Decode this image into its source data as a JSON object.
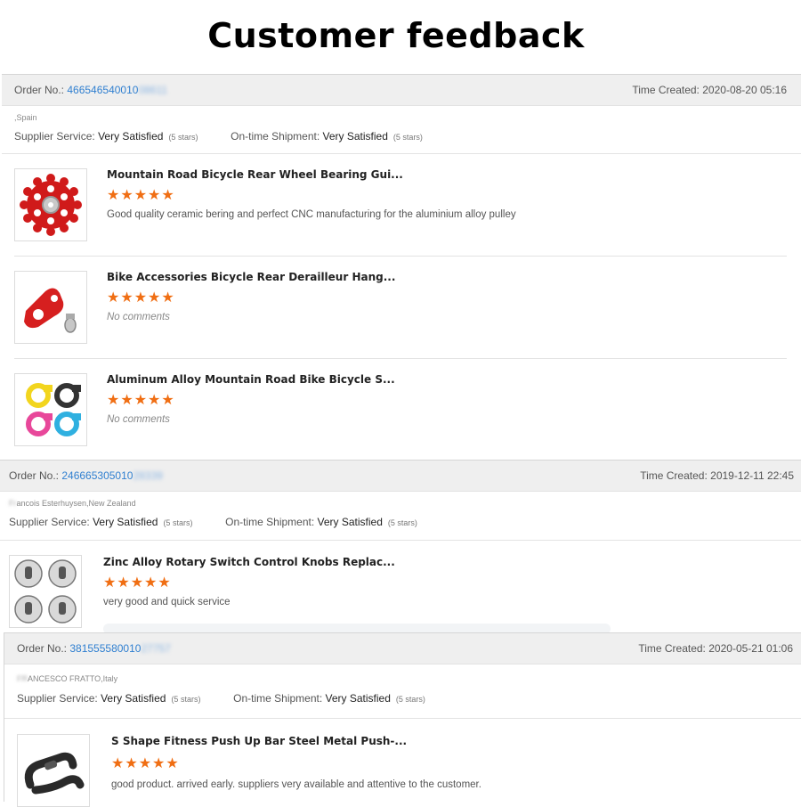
{
  "page": {
    "title": "Customer feedback"
  },
  "labels": {
    "order_no": "Order No.:",
    "time_created": "Time Created:",
    "supplier_service": "Supplier Service:",
    "on_time_shipment": "On-time Shipment:",
    "very_satisfied": "Very Satisfied",
    "five_stars": "(5 stars)",
    "stars": "★★★★★"
  },
  "orders": [
    {
      "order_no_visible": "466546540010",
      "order_no_blurred": "08611",
      "time": "2020-08-20 05:16",
      "buyer_blurred": "",
      "location": ",Spain",
      "items": [
        {
          "title": "Mountain Road Bicycle Rear Wheel Bearing Gui...",
          "rating": 5,
          "comment": "Good quality ceramic bering and perfect CNC manufacturing for the aluminium alloy pulley",
          "icon": "red-jockey-wheel-image"
        },
        {
          "title": "Bike Accessories Bicycle Rear Derailleur Hang...",
          "rating": 5,
          "comment": "No comments",
          "icon": "red-derailleur-hanger-image"
        },
        {
          "title": "Aluminum Alloy Mountain Road Bike Bicycle S...",
          "rating": 5,
          "comment": "No comments",
          "icon": "colored-seat-clamps-image"
        }
      ]
    },
    {
      "order_no_visible": "246665305010",
      "order_no_blurred": "28339",
      "time": "2019-12-11 22:45",
      "buyer_blurred": "Fr",
      "location": "ancois Esterhuysen,New Zealand",
      "items": [
        {
          "title": "Zinc Alloy Rotary Switch Control Knobs Replac...",
          "rating": 5,
          "comment": "very good and quick service",
          "icon": "metal-knobs-image"
        }
      ]
    },
    {
      "order_no_visible": "381555580010",
      "order_no_blurred": "27757",
      "time": "2020-05-21 01:06",
      "buyer_blurred": "FR",
      "location": "ANCESCO FRATTO,Italy",
      "items": [
        {
          "title": "S Shape Fitness Push Up Bar Steel Metal Push-...",
          "rating": 5,
          "comment": "good product. arrived early. suppliers very available and attentive to the customer.",
          "icon": "pushup-bar-image"
        }
      ]
    }
  ]
}
